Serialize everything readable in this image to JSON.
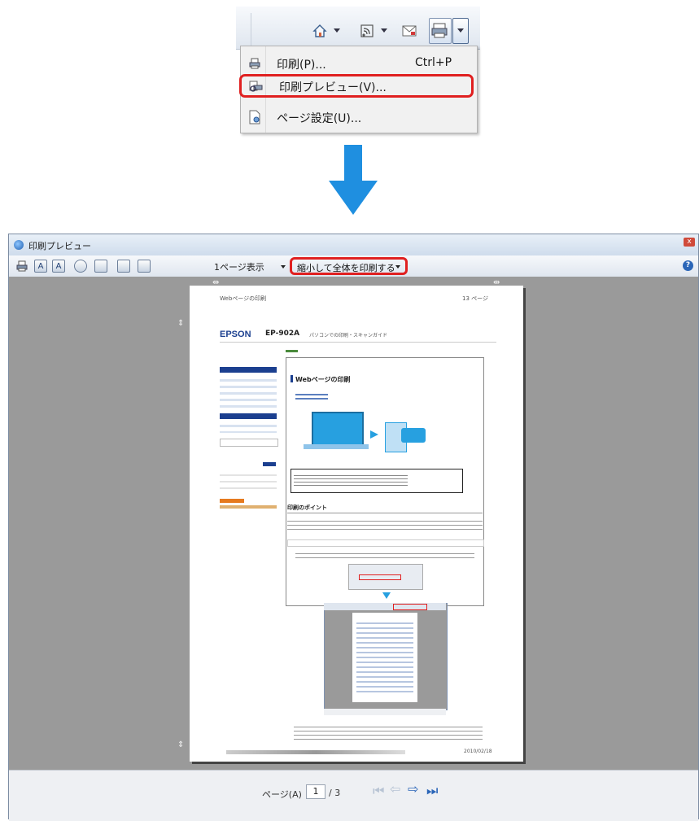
{
  "menu": {
    "items": [
      {
        "label": "印刷(P)...",
        "shortcut": "Ctrl+P",
        "icon": "printer-icon"
      },
      {
        "label": "印刷プレビュー(V)...",
        "shortcut": "",
        "icon": "print-preview-icon"
      },
      {
        "label": "ページ設定(U)...",
        "shortcut": "",
        "icon": "page-setup-icon"
      }
    ]
  },
  "preview_window": {
    "title": "印刷プレビュー",
    "close_label": "x",
    "help_label": "?",
    "view_mode": "1ページ表示",
    "shrink_option": "縮小して全体を印刷する",
    "toolbar_letters": [
      "A",
      "A"
    ]
  },
  "paper": {
    "header_left": "Webページの印刷",
    "header_right": "13 ページ",
    "brand": "EPSON",
    "model": "EP-902A",
    "guide_title": "パソコンでの印刷・スキャンガイド",
    "content_heading": "Webページの印刷",
    "section_heading": "印刷のポイント",
    "footer_date": "2010/02/18"
  },
  "status": {
    "page_label": "ページ(A)",
    "current_page": "1",
    "total_pages": "/ 3"
  },
  "colors": {
    "highlight": "#e02020",
    "arrow": "#1f8fe0",
    "preview_background": "#9a9a9a"
  }
}
